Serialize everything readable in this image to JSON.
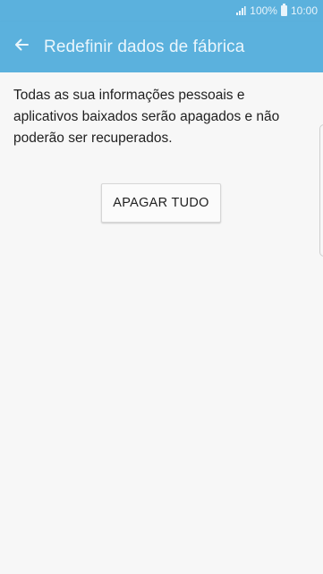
{
  "status_bar": {
    "battery_percent": "100%",
    "time": "10:00",
    "signal_icon": "signal-icon",
    "battery_icon": "battery-icon"
  },
  "app_bar": {
    "back_icon": "arrow-left-icon",
    "title": "Redefinir dados de fábrica"
  },
  "content": {
    "description": "Todas as sua informações pessoais e aplicativos baixados serão apagados e não poderão ser recuperados.",
    "wipe_button_label": "APAGAR TUDO"
  },
  "colors": {
    "accent": "#5bb1dd",
    "background": "#f7f7f7",
    "text": "#1f1f1f"
  }
}
